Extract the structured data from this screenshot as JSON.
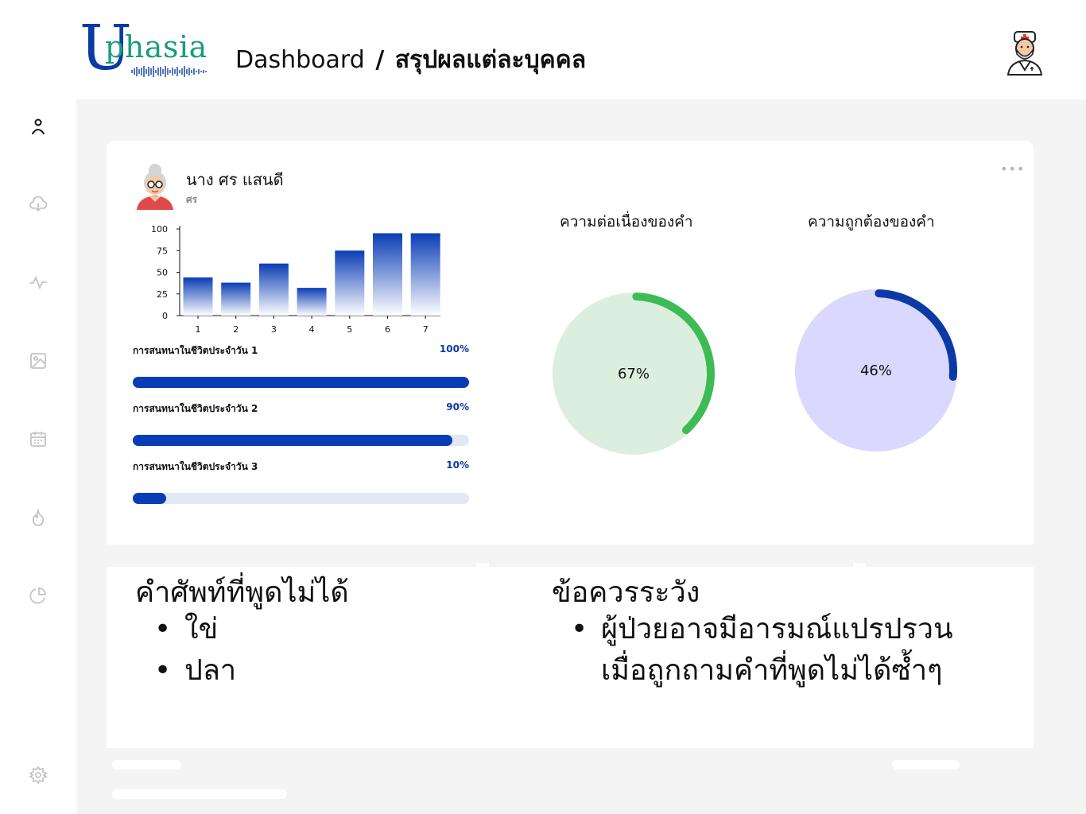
{
  "header": {
    "logo_letter": "U",
    "logo_rest": "phasia",
    "title": "Dashboard",
    "separator": "/",
    "subtitle": "สรุปผลแต่ละบุคคล"
  },
  "sidebar": {
    "items": [
      {
        "icon": "user-icon",
        "active": true
      },
      {
        "icon": "cloud-download-icon",
        "active": false
      },
      {
        "icon": "activity-icon",
        "active": false
      },
      {
        "icon": "image-icon",
        "active": false
      },
      {
        "icon": "calendar-icon",
        "active": false
      },
      {
        "icon": "flame-icon",
        "active": false
      },
      {
        "icon": "pie-chart-icon",
        "active": false
      }
    ],
    "footer_icon": "settings-icon"
  },
  "patient": {
    "name": "นาง ศร แสนดี",
    "short": "ศร"
  },
  "chart_data": [
    {
      "type": "bar",
      "categories": [
        "1",
        "2",
        "3",
        "4",
        "5",
        "6",
        "7"
      ],
      "values": [
        44,
        38,
        60,
        32,
        75,
        95,
        95
      ],
      "ylim": [
        0,
        100
      ],
      "yticks": [
        0,
        25,
        50,
        75,
        100
      ],
      "title": "",
      "xlabel": "",
      "ylabel": ""
    }
  ],
  "progress": [
    {
      "label": "การสนทนาในชีวิตประจำวัน 1",
      "value_text": "100%",
      "value": 1.0
    },
    {
      "label": "การสนทนาในชีวิตประจำวัน 2",
      "value_text": "90%",
      "value": 0.95
    },
    {
      "label": "การสนทนาในชีวิตประจำวัน 3",
      "value_text": "10%",
      "value": 0.1
    }
  ],
  "gauges": [
    {
      "title": "ความต่อเนื่องของคำ",
      "value_text": "67%",
      "value": 0.67,
      "color": "#3dbb55",
      "bg": "#dcefdf"
    },
    {
      "title": "ความถูกต้องของคำ",
      "value_text": "46%",
      "value": 0.46,
      "color": "#0b3aa6",
      "bg": "#dad8ff"
    }
  ],
  "words": {
    "title": "คำศัพท์ที่พูดไม่ได้",
    "items": [
      "ใข่",
      "ปลา"
    ]
  },
  "cautions": {
    "title": "ข้อควรระวัง",
    "items": [
      "ผู้ป่วยอาจมีอารมณ์แปรปรวน",
      "เมื่อถูกถามคำที่พูดไม่ได้ซ้ำๆ"
    ]
  },
  "colors": {
    "accent": "#0b3aa6",
    "green": "#3dbb55"
  }
}
